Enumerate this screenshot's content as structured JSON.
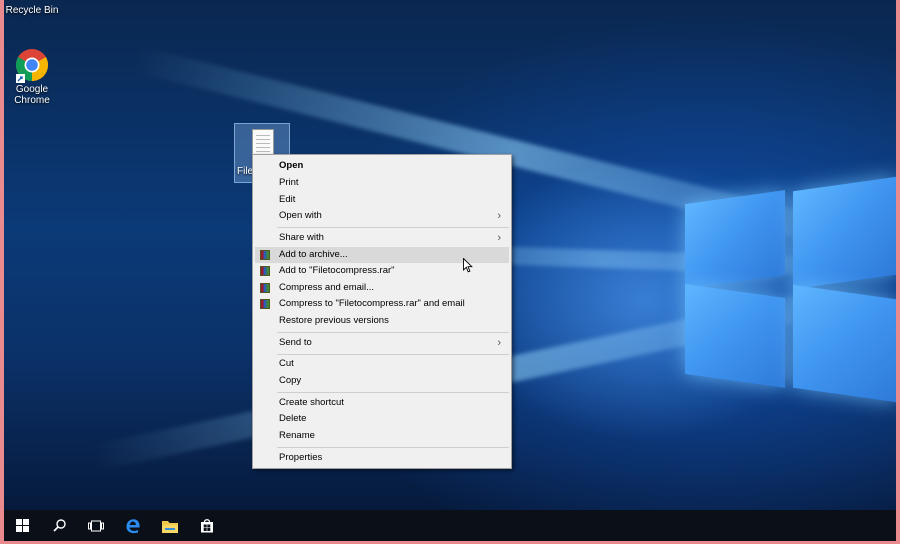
{
  "desktop": {
    "icons": [
      {
        "label": "Recycle Bin",
        "icon": "recycle-bin-icon"
      },
      {
        "label": "Google\nChrome",
        "icon": "chrome-icon"
      }
    ],
    "selected_file": {
      "label": "Fileto",
      "icon": "text-file-icon"
    }
  },
  "context_menu": {
    "items": [
      {
        "label": "Open",
        "bold": true
      },
      {
        "label": "Print"
      },
      {
        "label": "Edit"
      },
      {
        "label": "Open with",
        "submenu": true
      },
      {
        "label": "Share with",
        "submenu": true
      },
      {
        "label": "Add to archive...",
        "icon": "winrar-icon",
        "highlighted": true
      },
      {
        "label": "Add to \"Filetocompress.rar\"",
        "icon": "winrar-icon"
      },
      {
        "label": "Compress and email...",
        "icon": "winrar-icon"
      },
      {
        "label": "Compress to \"Filetocompress.rar\" and email",
        "icon": "winrar-icon"
      },
      {
        "label": "Restore previous versions"
      },
      {
        "label": "Send to",
        "submenu": true
      },
      {
        "label": "Cut"
      },
      {
        "label": "Copy"
      },
      {
        "label": "Create shortcut"
      },
      {
        "label": "Delete"
      },
      {
        "label": "Rename"
      },
      {
        "label": "Properties"
      }
    ],
    "submenu_glyph": "›"
  },
  "taskbar": {
    "items": [
      "start-icon",
      "search-icon",
      "task-view-icon",
      "edge-icon",
      "file-explorer-icon",
      "store-icon"
    ]
  },
  "colors": {
    "menu_bg": "#f0f0f0",
    "menu_highlight": "#d9d9d9",
    "taskbar_bg": "#0a0f18",
    "frame": "#e88a8e"
  }
}
